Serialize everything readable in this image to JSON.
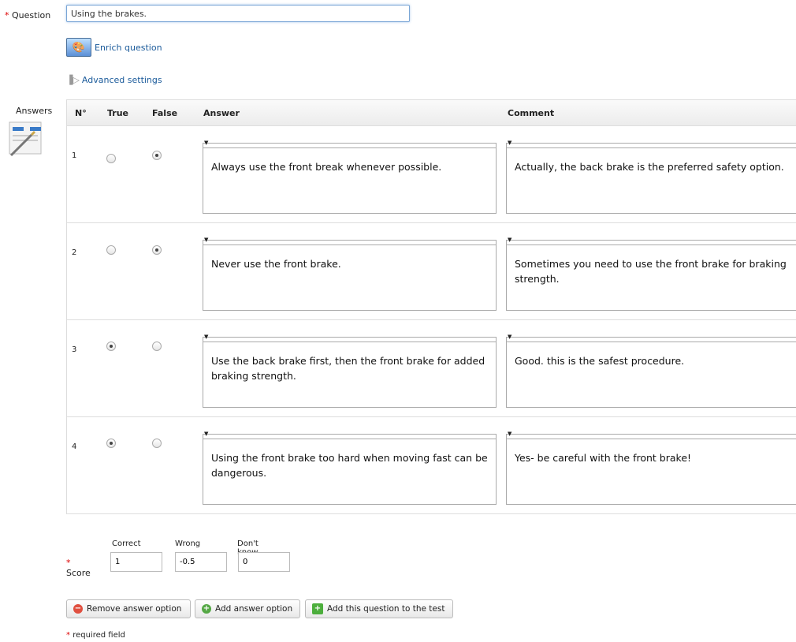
{
  "question": {
    "asterisk": "*",
    "label": "Question",
    "value": "Using the brakes."
  },
  "enrich": {
    "label": "Enrich question"
  },
  "advanced": {
    "label": "Advanced settings"
  },
  "answers_label": "Answers",
  "table": {
    "headers": {
      "num": "N°",
      "true": "True",
      "false": "False",
      "answer": "Answer",
      "comment": "Comment"
    },
    "rows": [
      {
        "num": "1",
        "selected": "false",
        "answer": "Always use the front break whenever possible.",
        "comment": "Actually, the back brake is the preferred safety option."
      },
      {
        "num": "2",
        "selected": "false",
        "answer": "Never use the front brake.",
        "comment": "Sometimes you need to use the front brake for braking strength."
      },
      {
        "num": "3",
        "selected": "true",
        "answer": "Use the back brake first, then the front brake for added braking strength.",
        "comment": "Good. this is the safest procedure."
      },
      {
        "num": "4",
        "selected": "true",
        "answer": "Using the front brake too hard when moving fast can be dangerous.",
        "comment": "Yes- be careful with the front brake!"
      }
    ]
  },
  "score": {
    "asterisk": "*",
    "label": "Score",
    "correct_label": "Correct",
    "wrong_label": "Wrong",
    "dontknow_label": "Don't know",
    "correct": "1",
    "wrong": "-0.5",
    "dontknow": "0"
  },
  "buttons": {
    "remove": "Remove answer option",
    "add": "Add answer option",
    "add_to_test": "Add this question to the test"
  },
  "footer": {
    "asterisk": "*",
    "note": "required field"
  },
  "colors": {
    "link": "#1a5a9a",
    "required": "#dd0000",
    "remove_icon": "#e05040",
    "add_icon": "#55a845"
  }
}
